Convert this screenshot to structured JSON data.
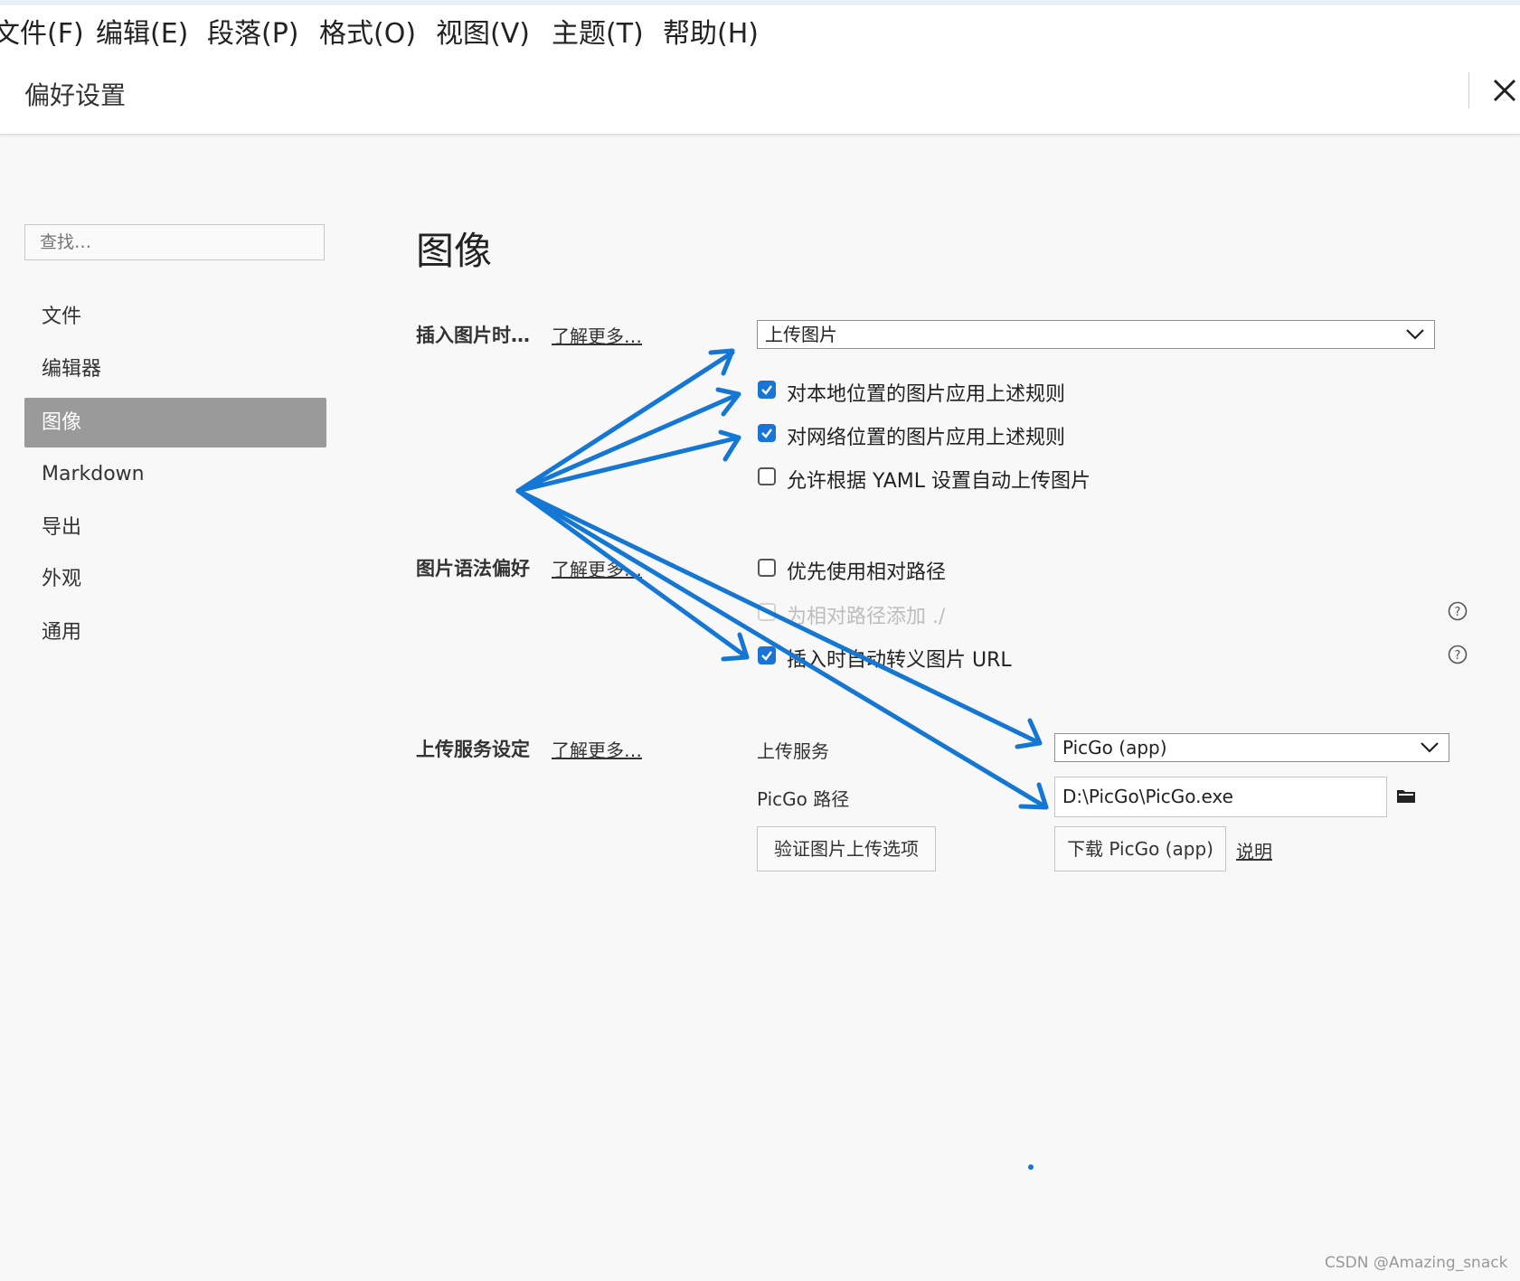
{
  "menu": {
    "file": "文件(F)",
    "edit": "编辑(E)",
    "paragraph": "段落(P)",
    "format": "格式(O)",
    "view": "视图(V)",
    "theme": "主题(T)",
    "help": "帮助(H)"
  },
  "header": {
    "title": "偏好设置",
    "close_icon": "close-icon"
  },
  "sidebar": {
    "search_placeholder": "查找…",
    "items": [
      {
        "label": "文件"
      },
      {
        "label": "编辑器"
      },
      {
        "label": "图像",
        "active": true
      },
      {
        "label": "Markdown"
      },
      {
        "label": "导出"
      },
      {
        "label": "外观"
      },
      {
        "label": "通用"
      }
    ]
  },
  "main": {
    "section_title": "图像",
    "insert": {
      "label": "插入图片时…",
      "learn_more": "了解更多…",
      "select_value": "上传图片",
      "options": [
        {
          "label": "对本地位置的图片应用上述规则",
          "checked": true
        },
        {
          "label": "对网络位置的图片应用上述规则",
          "checked": true
        },
        {
          "label": "允许根据 YAML 设置自动上传图片",
          "checked": false
        }
      ]
    },
    "syntax": {
      "label": "图片语法偏好",
      "learn_more": "了解更多…",
      "options": [
        {
          "label": "优先使用相对路径",
          "checked": false
        },
        {
          "label": "为相对路径添加 ./",
          "checked": false,
          "disabled": true
        },
        {
          "label": "插入时自动转义图片 URL",
          "checked": true
        }
      ]
    },
    "upload": {
      "label": "上传服务设定",
      "learn_more": "了解更多…",
      "service_label": "上传服务",
      "service_value": "PicGo (app)",
      "path_label": "PicGo 路径",
      "path_value": "D:\\PicGo\\PicGo.exe",
      "verify_button": "验证图片上传选项",
      "download_button": "下载 PicGo (app)",
      "docs_link": "说明"
    }
  },
  "colors": {
    "accent": "#1a73d6",
    "annotation_arrow": "#1577d4",
    "sidebar_active_bg": "#9a9a9a"
  },
  "watermark": "CSDN @Amazing_snack"
}
